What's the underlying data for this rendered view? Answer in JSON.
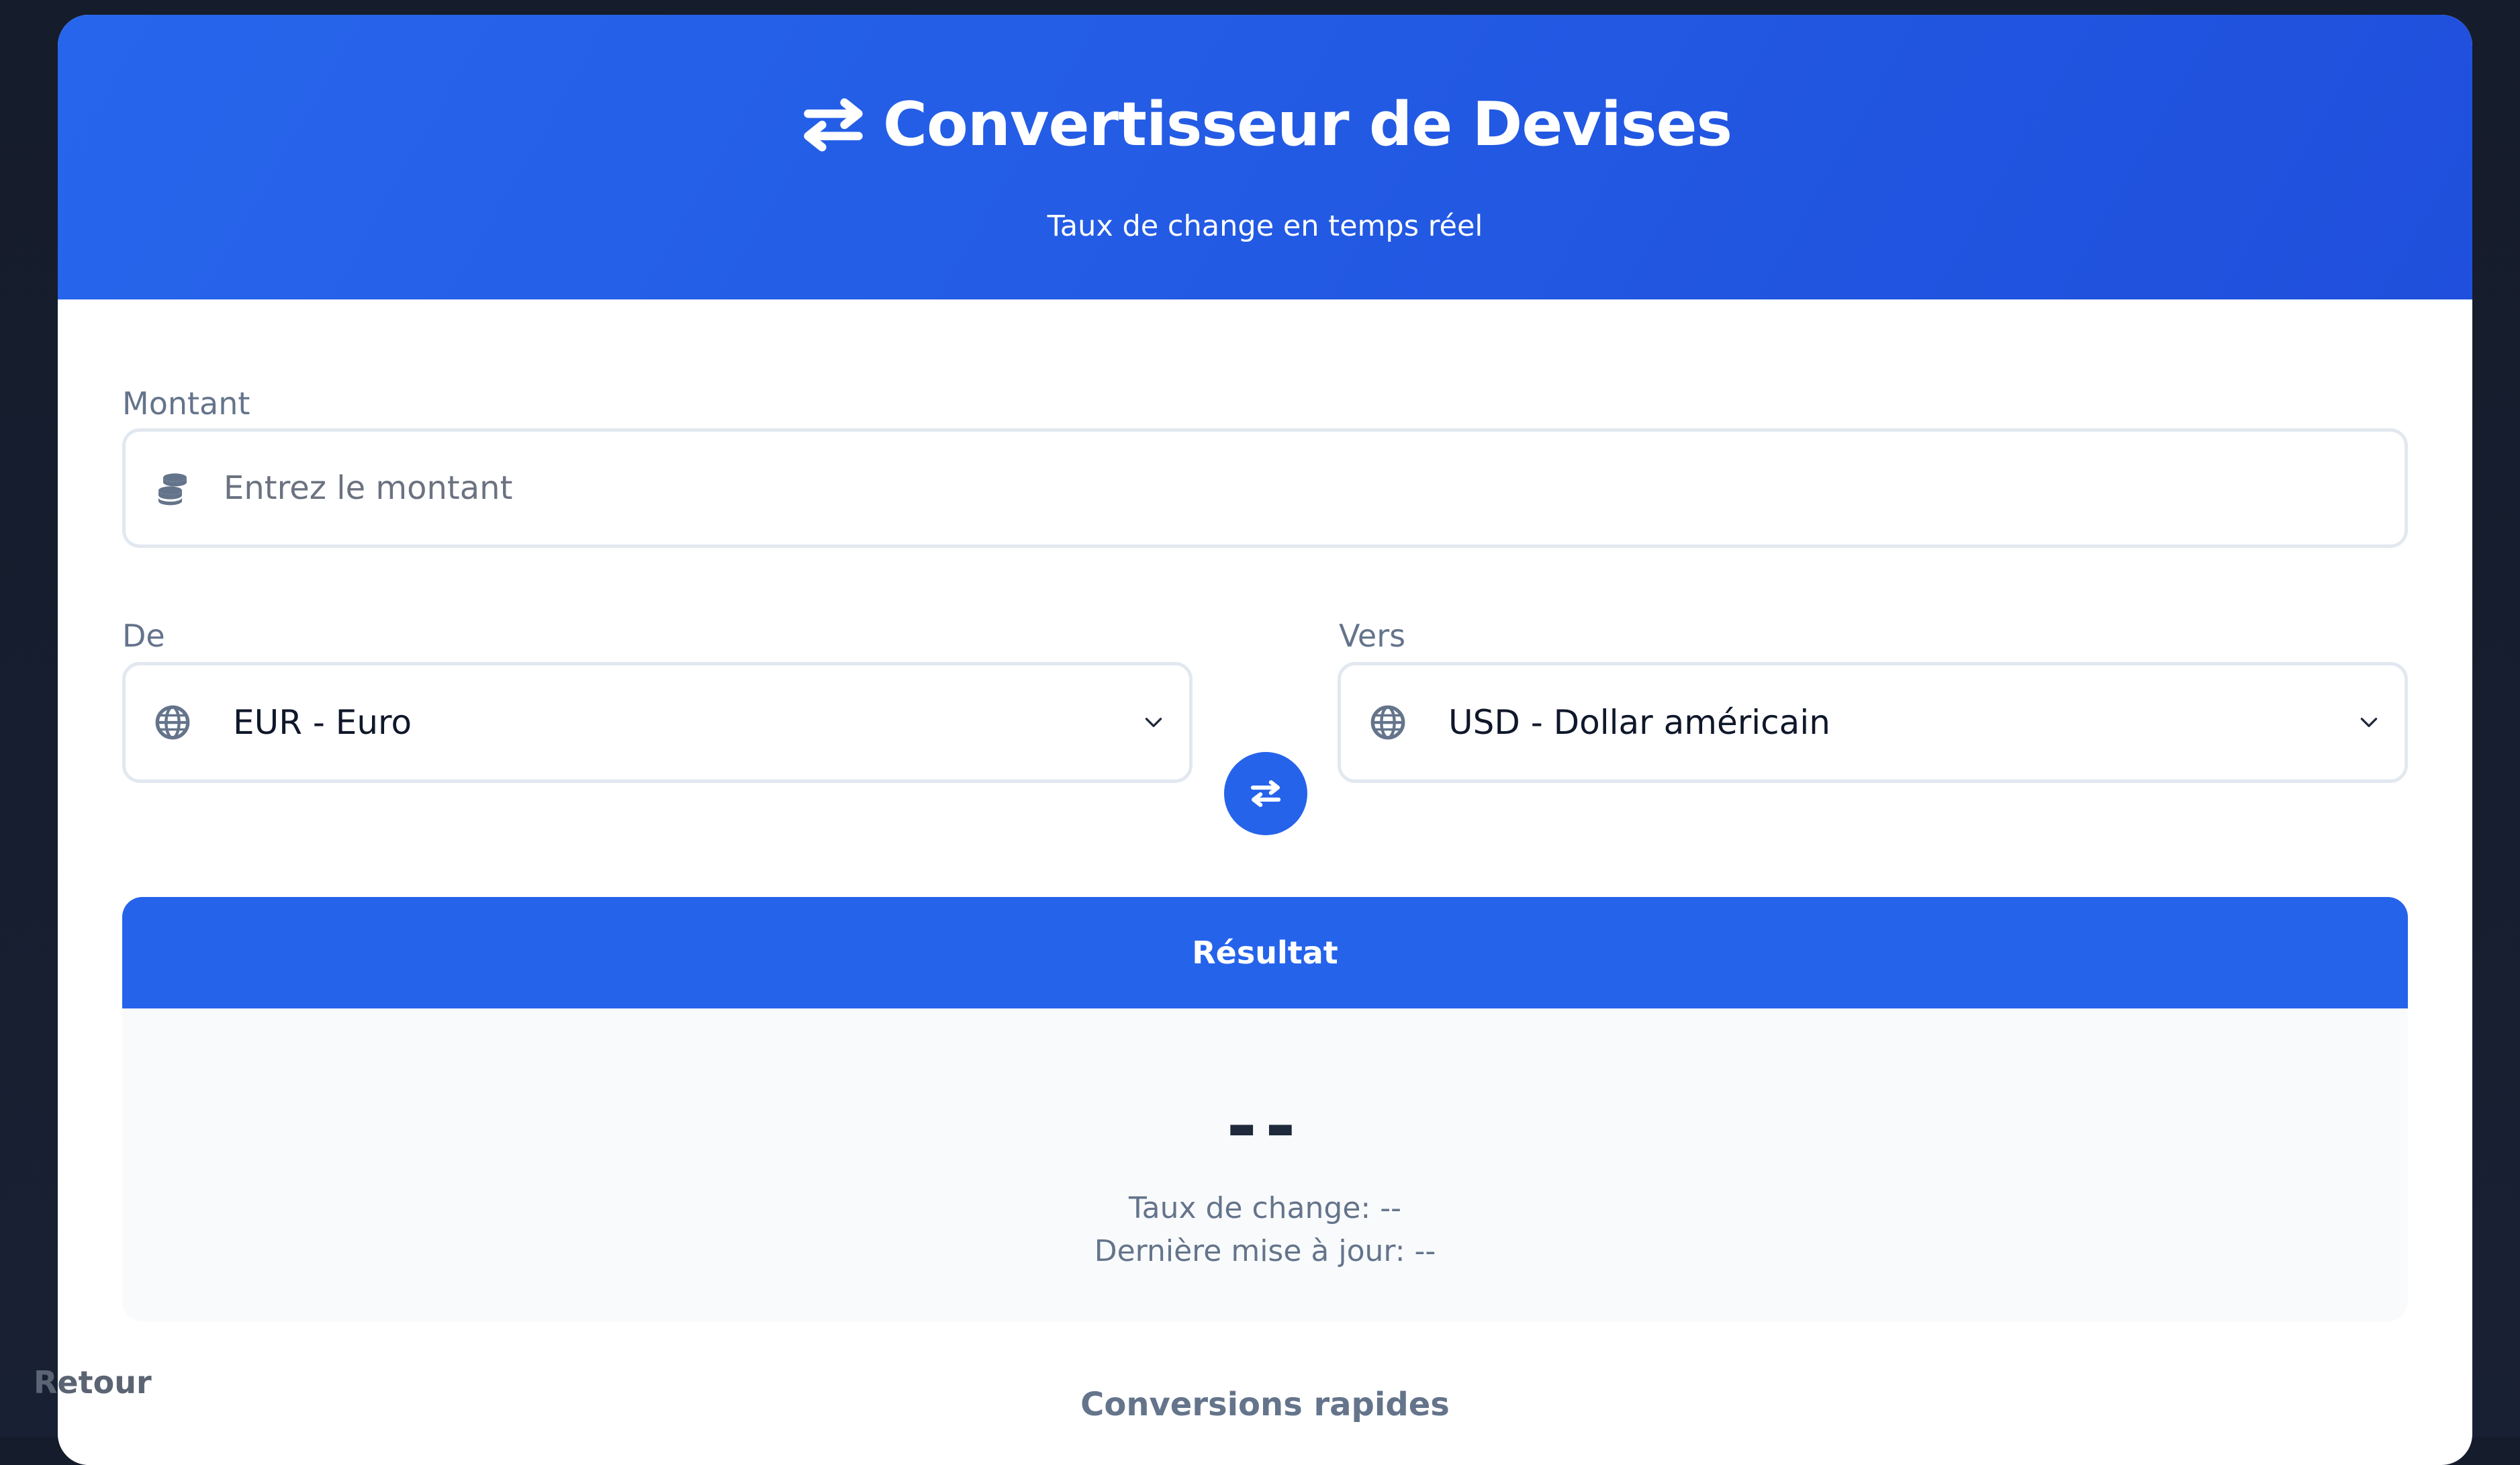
{
  "header": {
    "title": "Convertisseur de Devises",
    "subtitle": "Taux de change en temps réel",
    "icon": "exchange-icon"
  },
  "amount": {
    "label": "Montant",
    "placeholder": "Entrez le montant",
    "value": "",
    "icon": "coins-icon"
  },
  "from": {
    "label": "De",
    "selected": "EUR - Euro",
    "icon": "globe-icon"
  },
  "to": {
    "label": "Vers",
    "selected": "USD - Dollar américain",
    "icon": "globe-icon"
  },
  "swap_button": {
    "icon": "exchange-icon"
  },
  "result": {
    "header": "Résultat",
    "value": "--",
    "rate_line": "Taux de change: --",
    "updated_line": "Dernière mise à jour: --"
  },
  "quick_conversions": {
    "title": "Conversions rapides"
  },
  "back_link": "Retour",
  "colors": {
    "primary": "#2563eb",
    "header_gradient_start": "#2766ec",
    "header_gradient_end": "#1f4fdc",
    "page_background": "#151c2b",
    "text_muted": "#64748b"
  }
}
